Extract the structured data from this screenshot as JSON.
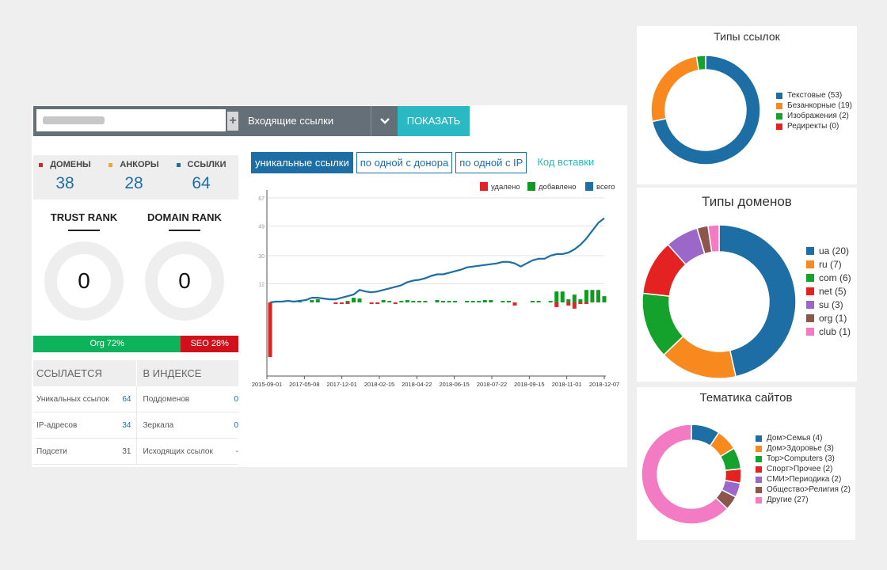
{
  "toolbar": {
    "url_value": "",
    "mode_label": "Входящие ссылки",
    "show_label": "ПОКАЗАТЬ"
  },
  "stats": [
    {
      "label": "ДОМЕНЫ",
      "value": "38",
      "color": "#e02020"
    },
    {
      "label": "АНКОРЫ",
      "value": "28",
      "color": "#f5a623"
    },
    {
      "label": "ССЫЛКИ",
      "value": "64",
      "color": "#1c6ea4"
    }
  ],
  "ranks": {
    "trust_title": "TRUST RANK",
    "trust_value": "0",
    "domain_title": "DOMAIN RANK",
    "domain_value": "0"
  },
  "org_seo": {
    "org_label": "Org 72%",
    "seo_label": "SEO 28%",
    "org_share": 0.72
  },
  "link_table": {
    "head_left": "ССЫЛАЕТСЯ",
    "head_right": "В ИНДЕКСЕ",
    "rows": [
      {
        "l_label": "Уникальных ссылок",
        "l_value": "64",
        "r_label": "Поддоменов",
        "r_value": "0"
      },
      {
        "l_label": "IP-адресов",
        "l_value": "34",
        "r_label": "Зеркала",
        "r_value": "0"
      },
      {
        "l_label": "Подсети",
        "l_value": "31",
        "r_label": "Исходящих ссылок",
        "r_value": "-"
      }
    ]
  },
  "tabs": [
    "уникальные ссылки",
    "по одной с донора",
    "по одной с IP",
    "Код вставки"
  ],
  "chart_data": [
    {
      "type": "line",
      "title": "",
      "legend": [
        {
          "name": "удалено",
          "color": "#e52222"
        },
        {
          "name": "добавлено",
          "color": "#0f9b1f"
        },
        {
          "name": "всего",
          "color": "#1c6ea4"
        }
      ],
      "y_ticks": [
        67,
        49,
        30,
        12
      ],
      "x_ticks": [
        "2015-09-01",
        "2017-05-08",
        "2017-12-01",
        "2018-02-15",
        "2018-04-22",
        "2018-06-15",
        "2018-07-22",
        "2018-09-15",
        "2018-11-01",
        "2018-12-07"
      ],
      "series": [
        {
          "name": "всего",
          "values": [
            0,
            0.5,
            0.5,
            1,
            0.5,
            1,
            1.5,
            3,
            3,
            2.5,
            2,
            2,
            3,
            4,
            5,
            8,
            7,
            6.5,
            7,
            8,
            9,
            10,
            11,
            13,
            14,
            14.5,
            15.5,
            17,
            18,
            18,
            19,
            20,
            21,
            22.5,
            23,
            23.5,
            24,
            24.5,
            25,
            26,
            26,
            25,
            23,
            25,
            27,
            28,
            28,
            30,
            31,
            31,
            32,
            34,
            37,
            41,
            46,
            51,
            54
          ]
        },
        {
          "name": "добавлено",
          "values": [
            0,
            0,
            0.5,
            0,
            0,
            0.5,
            0,
            1.5,
            2,
            0,
            0,
            0,
            0,
            1,
            3,
            2.5,
            0,
            0,
            0,
            1.5,
            1,
            0,
            1,
            1.5,
            1,
            1,
            1,
            0,
            1.5,
            1,
            1,
            1,
            0,
            1,
            1,
            1,
            1.5,
            1.5,
            0,
            1,
            1,
            0,
            0,
            0,
            1,
            1,
            0,
            1,
            7,
            7,
            2,
            5,
            2,
            8,
            8,
            8,
            4
          ]
        },
        {
          "name": "удалено",
          "values": [
            35,
            0,
            0,
            0,
            0,
            0,
            0,
            0,
            0,
            0,
            0,
            1,
            1,
            1,
            0,
            0,
            0,
            1,
            1,
            0,
            0,
            1,
            0,
            0,
            0,
            0,
            0,
            0,
            0,
            0,
            0,
            0,
            0,
            0,
            0,
            0,
            0,
            0,
            0,
            0,
            0,
            2,
            0,
            0,
            0,
            0,
            0,
            0,
            3,
            0,
            2,
            4,
            1,
            1,
            0,
            0,
            0
          ]
        }
      ]
    },
    {
      "type": "pie",
      "title": "Типы ссылок",
      "categories": [
        "Текстовые (53)",
        "Безанкорные (19)",
        "Изображения (2)",
        "Редиректы (0)"
      ],
      "values": [
        53,
        19,
        2,
        0
      ],
      "colors": [
        "#1c6ea4",
        "#f7891f",
        "#15a22c",
        "#e52222"
      ]
    },
    {
      "type": "pie",
      "title": "Типы доменов",
      "categories": [
        "ua (20)",
        "ru (7)",
        "com (6)",
        "net (5)",
        "su (3)",
        "org (1)",
        "club (1)"
      ],
      "values": [
        20,
        7,
        6,
        5,
        3,
        1,
        1
      ],
      "colors": [
        "#1c6ea4",
        "#f7891f",
        "#15a22c",
        "#e52222",
        "#9b67c8",
        "#8c564b",
        "#f27bc3"
      ]
    },
    {
      "type": "pie",
      "title": "Тематика сайтов",
      "categories": [
        "Дом>Семья (4)",
        "Дом>Здоровье (3)",
        "Top>Computers (3)",
        "Спорт>Прочее (2)",
        "СМИ>Периодика (2)",
        "Общество>Религия (2)",
        "Другие (27)"
      ],
      "values": [
        4,
        3,
        3,
        2,
        2,
        2,
        27
      ],
      "colors": [
        "#1c6ea4",
        "#f7891f",
        "#15a22c",
        "#e52222",
        "#9b67c8",
        "#8c564b",
        "#f27bc3"
      ]
    }
  ]
}
